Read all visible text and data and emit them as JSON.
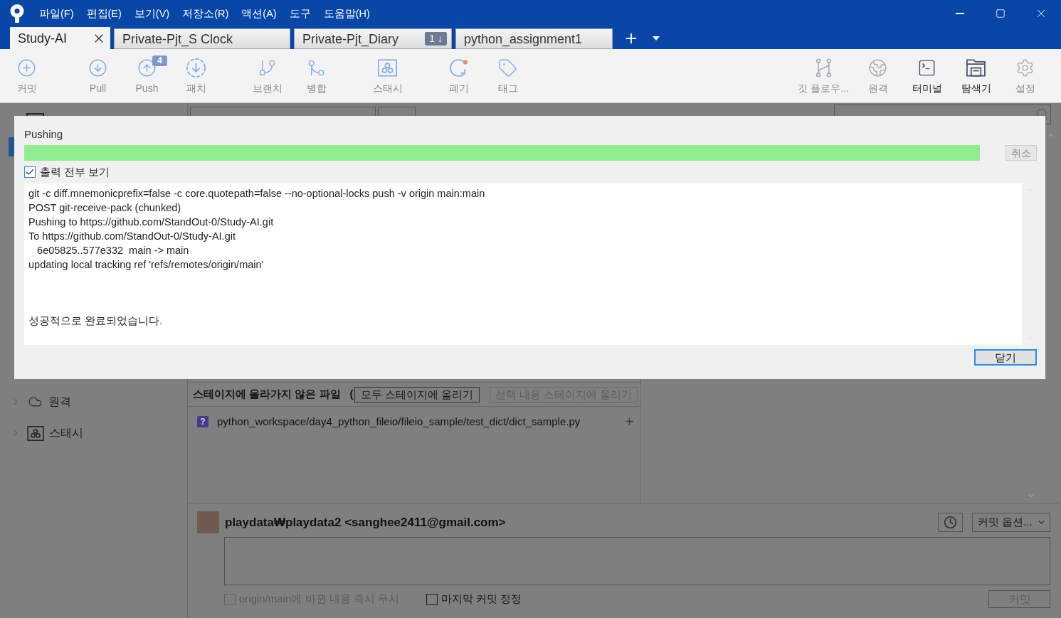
{
  "window": {
    "menu": [
      "파일(F)",
      "편집(E)",
      "보기(V)",
      "저장소(R)",
      "액션(A)",
      "도구",
      "도움말(H)"
    ]
  },
  "tabs": [
    {
      "label": "Study-AI",
      "selected": true
    },
    {
      "label": "Private-Pjt_S Clock",
      "selected": false
    },
    {
      "label": "Private-Pjt_Diary",
      "selected": false,
      "badge": "1 ↓"
    },
    {
      "label": "python_assignment1",
      "selected": false
    }
  ],
  "toolbar": {
    "left": [
      {
        "label": "커밋",
        "disabled": true
      },
      {
        "label": "Pull",
        "disabled": true
      },
      {
        "label": "Push",
        "disabled": true,
        "badge": "4"
      },
      {
        "label": "패치",
        "disabled": true
      },
      {
        "label": "브랜치",
        "disabled": true
      },
      {
        "label": "병합",
        "disabled": true
      },
      {
        "label": "스태시",
        "disabled": true
      },
      {
        "label": "폐기",
        "disabled": true
      },
      {
        "label": "태그",
        "disabled": true
      }
    ],
    "right": [
      {
        "label": "깃 플로우...",
        "disabled": true
      },
      {
        "label": "원격",
        "disabled": true
      },
      {
        "label": "터미널",
        "disabled": false
      },
      {
        "label": "탐색기",
        "disabled": false
      },
      {
        "label": "설정",
        "disabled": true
      }
    ]
  },
  "dialog": {
    "title": "Pushing",
    "progress": {
      "level": 1
    },
    "cancel_button": {
      "label": "취소",
      "disabled": true
    },
    "show_full_output": {
      "label": "출력 전부 보기",
      "checked": true
    },
    "output_lines": [
      "git -c diff.mnemonicprefix=false -c core.quotepath=false --no-optional-locks push -v origin main:main",
      "POST git-receive-pack (chunked)",
      "Pushing to https://github.com/StandOut-0/Study-AI.git",
      "To https://github.com/StandOut-0/Study-AI.git",
      "   6e05825..577e332  main -> main",
      "updating local tracking ref 'refs/remotes/origin/main'"
    ],
    "result_message": "성공적으로 완료되었습니다.",
    "close_button": {
      "label": "닫기",
      "focused": true
    }
  },
  "sidebar": {
    "items": [
      {
        "label": "원격",
        "expanded": false
      },
      {
        "label": "스태시",
        "expanded": false
      }
    ]
  },
  "unstaged": {
    "title": "스테이지에 올라가지 않은 파일",
    "title_suffix": "(",
    "stage_all_button": {
      "label": "모두 스테이지에 올리기",
      "disabled": false
    },
    "stage_selected_button": {
      "label": "선택 내용 스테이지에 올리기",
      "disabled": true
    },
    "files": [
      {
        "status": "?",
        "path": "python_workspace/day4_python_fileio/fileio_sample/test_dict/dict_sample.py"
      }
    ]
  },
  "commit": {
    "author": "playdata₩playdata2 <sanghee2411@gmail.com>",
    "options_button": {
      "label": "커밋 옵션..."
    },
    "push_immediately": {
      "label": "origin/main에 바뀐 내용 즉시 푸시",
      "checked": false,
      "disabled": true
    },
    "amend": {
      "label": "마지막 커밋 정정",
      "checked": false
    },
    "commit_button": {
      "label": "커밋",
      "disabled": true
    }
  }
}
